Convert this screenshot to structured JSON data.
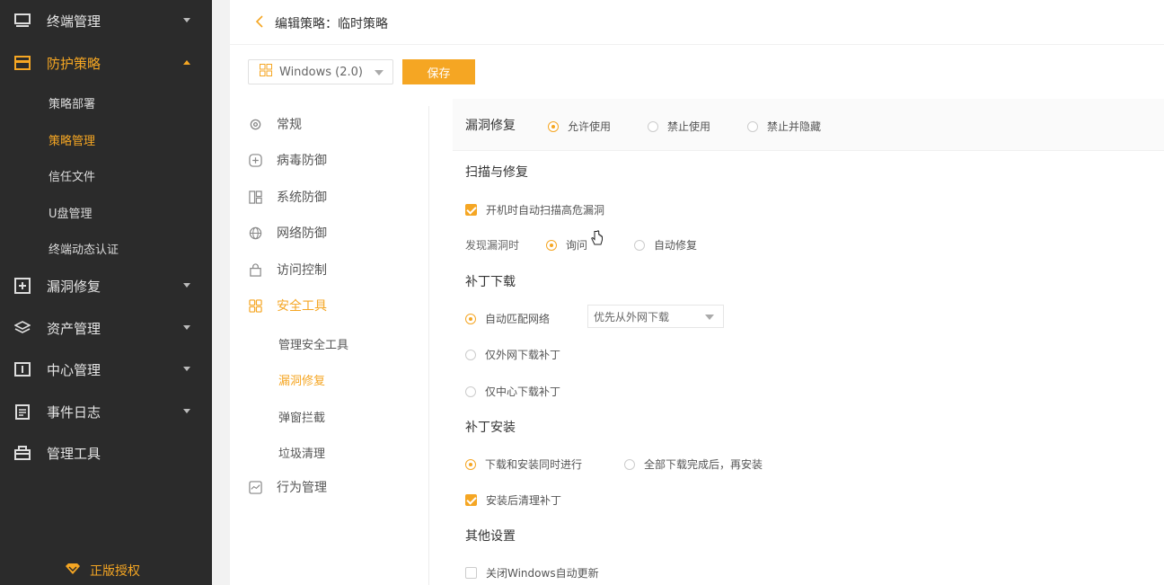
{
  "sidebar": {
    "items": [
      {
        "label": "终端管理",
        "icon": "monitor-icon"
      },
      {
        "label": "防护策略",
        "icon": "shield-card-icon"
      },
      {
        "label": "漏洞修复",
        "icon": "plus-square-icon"
      },
      {
        "label": "资产管理",
        "icon": "layers-icon"
      },
      {
        "label": "中心管理",
        "icon": "info-box-icon"
      },
      {
        "label": "事件日志",
        "icon": "calendar-log-icon"
      },
      {
        "label": "管理工具",
        "icon": "toolbox-icon"
      }
    ],
    "sub_items": [
      "策略部署",
      "策略管理",
      "信任文件",
      "U盘管理",
      "终端动态认证"
    ],
    "license": "正版授权"
  },
  "header": {
    "title": "编辑策略：临时策略"
  },
  "toolbar": {
    "os_select": "Windows (2.0)",
    "save_label": "保存"
  },
  "policy_nav": {
    "items": [
      "常规",
      "病毒防御",
      "系统防御",
      "网络防御",
      "访问控制",
      "安全工具",
      "行为管理"
    ],
    "tool_sub_items": [
      "管理安全工具",
      "漏洞修复",
      "弹窗拦截",
      "垃圾清理"
    ]
  },
  "content": {
    "head": {
      "label": "漏洞修复",
      "options": [
        "允许使用",
        "禁止使用",
        "禁止并隐藏"
      ],
      "selected": "允许使用"
    },
    "scan": {
      "title": "扫描与修复",
      "auto_scan_label": "开机时自动扫描高危漏洞",
      "auto_scan_checked": true,
      "found_label": "发现漏洞时",
      "found_options": [
        "询问",
        "自动修复"
      ],
      "found_selected": "询问"
    },
    "download": {
      "title": "补丁下载",
      "options": [
        "自动匹配网络",
        "仅外网下载补丁",
        "仅中心下载补丁"
      ],
      "selected": "自动匹配网络",
      "source_select": "优先从外网下载"
    },
    "install": {
      "title": "补丁安装",
      "options": [
        "下载和安装同时进行",
        "全部下载完成后，再安装"
      ],
      "selected": "下载和安装同时进行",
      "cleanup_label": "安装后清理补丁",
      "cleanup_checked": true
    },
    "other": {
      "title": "其他设置",
      "disable_update_label": "关闭Windows自动更新",
      "disable_update_checked": false
    }
  },
  "colors": {
    "accent": "#f5a623",
    "sidebar_bg": "#2b2b2b"
  }
}
